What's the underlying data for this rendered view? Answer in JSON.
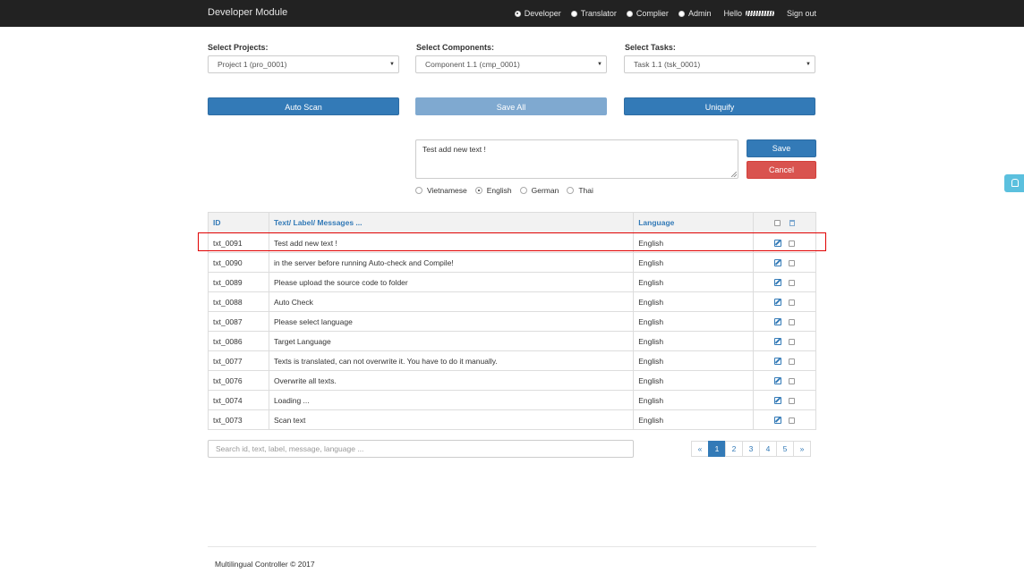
{
  "navbar": {
    "brand": "Developer Module",
    "roles": [
      {
        "label": "Developer",
        "selected": true
      },
      {
        "label": "Translator",
        "selected": false
      },
      {
        "label": "Complier",
        "selected": false
      },
      {
        "label": "Admin",
        "selected": false
      }
    ],
    "hello": "Hello",
    "sign_out": "Sign out"
  },
  "filters": {
    "projects_label": "Select Projects:",
    "projects_value": "Project 1 (pro_0001)",
    "components_label": "Select Components:",
    "components_value": "Component 1.1 (cmp_0001)",
    "tasks_label": "Select Tasks:",
    "tasks_value": "Task 1.1 (tsk_0001)"
  },
  "actions": {
    "auto_scan": "Auto Scan",
    "save_all": "Save All",
    "uniquify": "Uniquify"
  },
  "editor": {
    "text": "Test add new text !",
    "save": "Save",
    "cancel": "Cancel",
    "languages": [
      {
        "label": "Vietnamese",
        "selected": false
      },
      {
        "label": "English",
        "selected": true
      },
      {
        "label": "German",
        "selected": false
      },
      {
        "label": "Thai",
        "selected": false
      }
    ]
  },
  "table": {
    "headers": {
      "id": "ID",
      "text": "Text/ Label/ Messages ...",
      "language": "Language"
    },
    "rows": [
      {
        "id": "txt_0091",
        "text": "Test add new text !",
        "language": "English"
      },
      {
        "id": "txt_0090",
        "text": "in the server before running Auto-check and Compile!",
        "language": "English"
      },
      {
        "id": "txt_0089",
        "text": "Please upload the source code to folder",
        "language": "English"
      },
      {
        "id": "txt_0088",
        "text": "Auto Check",
        "language": "English"
      },
      {
        "id": "txt_0087",
        "text": "Please select language",
        "language": "English"
      },
      {
        "id": "txt_0086",
        "text": "Target Language",
        "language": "English"
      },
      {
        "id": "txt_0077",
        "text": "Texts is translated, can not overwrite it. You have to do it manually.",
        "language": "English"
      },
      {
        "id": "txt_0076",
        "text": "Overwrite all texts.",
        "language": "English"
      },
      {
        "id": "txt_0074",
        "text": "Loading ...",
        "language": "English"
      },
      {
        "id": "txt_0073",
        "text": "Scan text",
        "language": "English"
      }
    ]
  },
  "search": {
    "placeholder": "Search id, text, label, message, language ..."
  },
  "pagination": {
    "prev": "«",
    "pages": [
      "1",
      "2",
      "3",
      "4",
      "5"
    ],
    "next": "»",
    "active": "1"
  },
  "footer": {
    "text": "Multilingual Controller © 2017"
  }
}
